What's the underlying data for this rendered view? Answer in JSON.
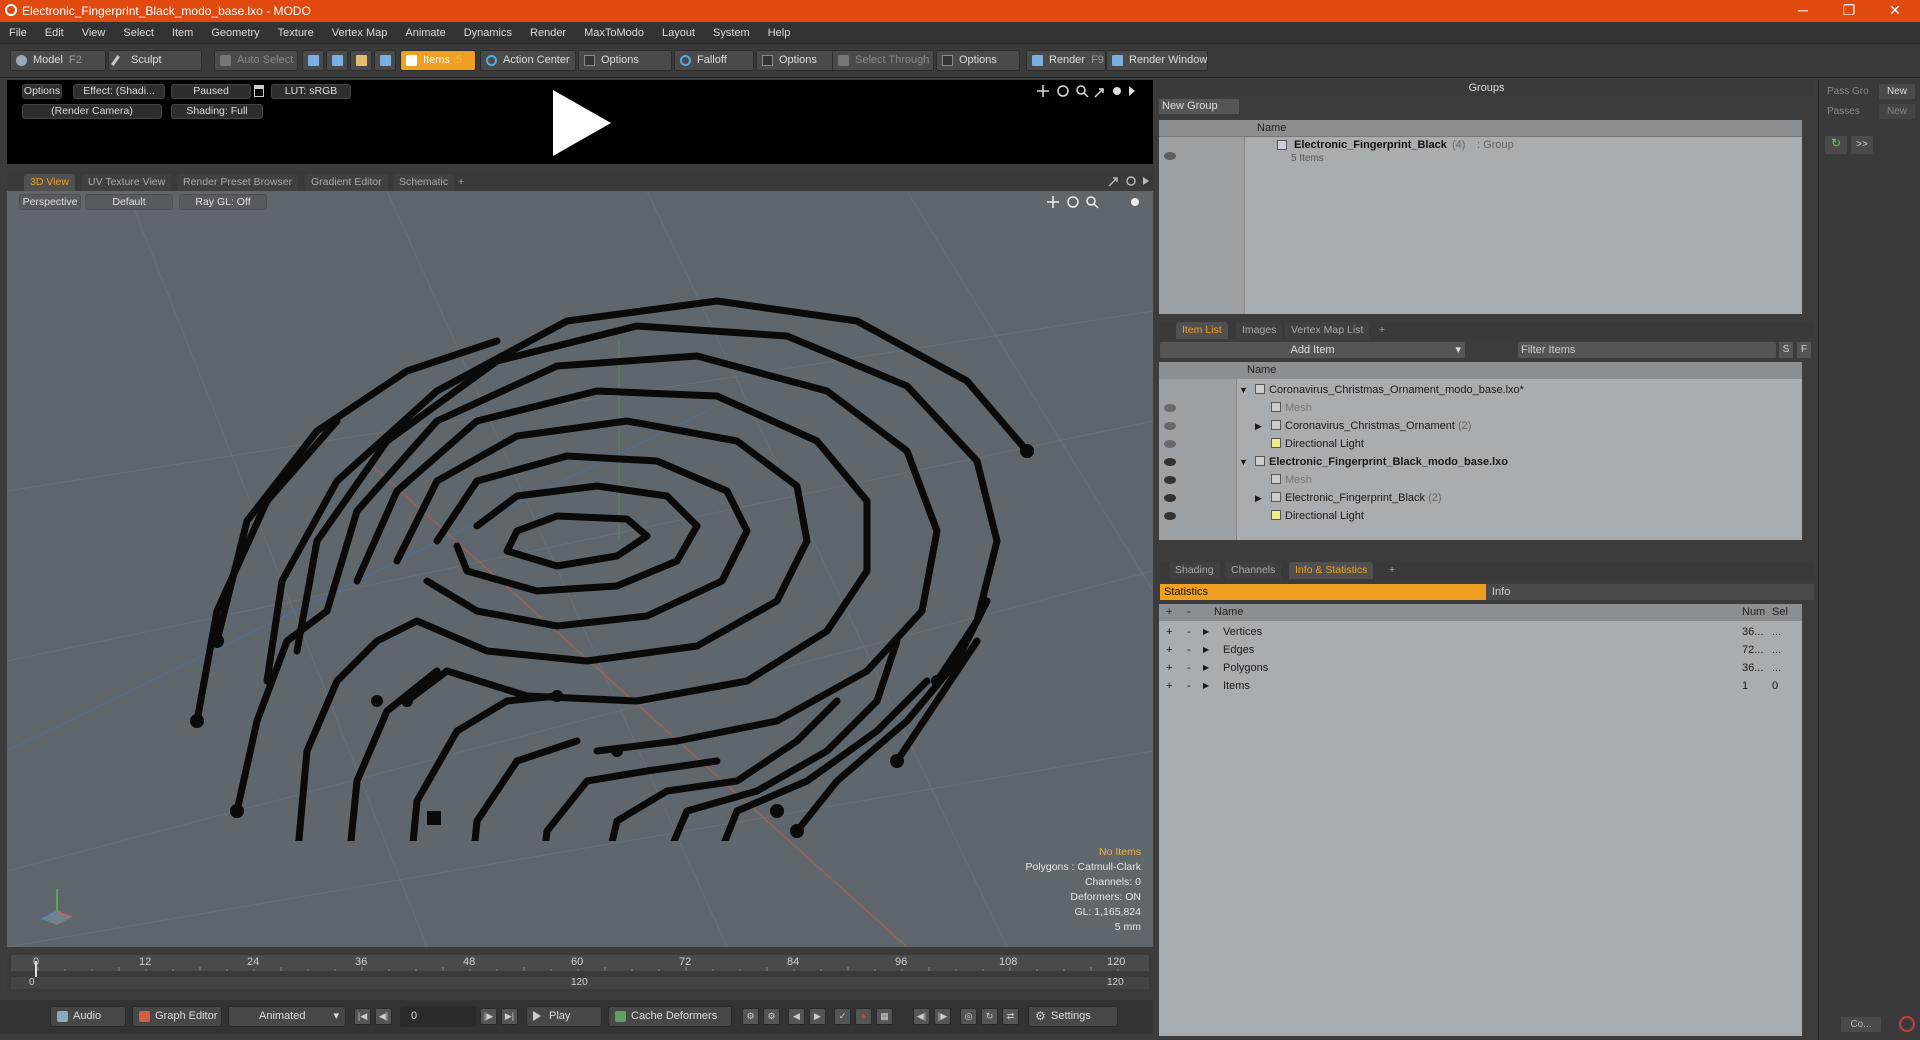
{
  "window": {
    "title": "Electronic_Fingerprint_Black_modo_base.lxo - MODO",
    "minimize": "─",
    "maximize": "❐",
    "close": "✕"
  },
  "menu": [
    "File",
    "Edit",
    "View",
    "Select",
    "Item",
    "Geometry",
    "Texture",
    "Vertex Map",
    "Animate",
    "Dynamics",
    "Render",
    "MaxToModo",
    "Layout",
    "System",
    "Help"
  ],
  "toolbar": {
    "model": "Model",
    "model_key": "F2",
    "sculpt": "Sculpt",
    "auto_select": "Auto Select",
    "items": "Items",
    "items_key": "5",
    "action_center": "Action Center",
    "options1": "Options",
    "falloff": "Falloff",
    "options2": "Options",
    "select_through": "Select Through",
    "options3": "Options",
    "render": "Render",
    "render_key": "F9",
    "render_window": "Render Window"
  },
  "preview": {
    "options": "Options",
    "effect": "Effect: (Shadi...",
    "paused": "Paused",
    "lut": "LUT: sRGB",
    "camera": "(Render Camera)",
    "shading": "Shading: Full"
  },
  "view_tabs": [
    "3D View",
    "UV Texture View",
    "Render Preset Browser",
    "Gradient Editor",
    "Schematic",
    "+"
  ],
  "viewport": {
    "perspective": "Perspective",
    "default": "Default",
    "raygl": "Ray GL: Off",
    "info": {
      "no_items": "No Items",
      "polygons": "Polygons : Catmull-Clark",
      "channels": "Channels: 0",
      "deformers": "Deformers: ON",
      "gl": "GL: 1,165,824",
      "scale": "5 mm"
    }
  },
  "timeline": {
    "ticks": [
      "0",
      "12",
      "24",
      "36",
      "48",
      "60",
      "72",
      "84",
      "96",
      "108",
      "120"
    ],
    "lower_start": "0",
    "lower_mid": "120",
    "lower_end": "120"
  },
  "bottom": {
    "audio": "Audio",
    "graph_editor": "Graph Editor",
    "animated": "Animated",
    "frame": "0",
    "play": "Play",
    "cache": "Cache Deformers",
    "settings": "Settings"
  },
  "groups": {
    "title": "Groups",
    "new_group": "New Group",
    "col_name": "Name",
    "row_name": "Electronic_Fingerprint_Black",
    "row_count": "(4)",
    "row_type": ": Group",
    "row_sub": "5 Items"
  },
  "side": {
    "pass_group": "Pass Gro",
    "new1": "New",
    "passes": "Passes",
    "new2": "New",
    "more": ">>",
    "co": "Co..."
  },
  "item_tabs": [
    "Item List",
    "Images",
    "Vertex Map List",
    "+"
  ],
  "item_list": {
    "add_item": "Add Item",
    "filter": "Filter Items",
    "s": "S",
    "f": "F",
    "col_name": "Name",
    "rows": [
      {
        "name": "Coronavirus_Christmas_Ornament_modo_base.lxo*",
        "indent": 0,
        "bold": false
      },
      {
        "name": "Mesh",
        "indent": 1,
        "bold": false
      },
      {
        "name": "Coronavirus_Christmas_Ornament",
        "suffix": "(2)",
        "indent": 1,
        "bold": false
      },
      {
        "name": "Directional Light",
        "indent": 1,
        "bold": false
      },
      {
        "name": "Electronic_Fingerprint_Black_modo_base.lxo",
        "indent": 0,
        "bold": true
      },
      {
        "name": "Mesh",
        "indent": 1,
        "bold": false
      },
      {
        "name": "Electronic_Fingerprint_Black",
        "suffix": "(2)",
        "indent": 1,
        "bold": false
      },
      {
        "name": "Directional Light",
        "indent": 1,
        "bold": false
      }
    ]
  },
  "stat_tabs": [
    "Shading",
    "Channels",
    "Info & Statistics",
    "+"
  ],
  "stats": {
    "statistics": "Statistics",
    "info": "Info",
    "col_name": "Name",
    "col_num": "Num",
    "col_sel": "Sel",
    "rows": [
      {
        "name": "Vertices",
        "num": "36...",
        "sel": "..."
      },
      {
        "name": "Edges",
        "num": "72...",
        "sel": "..."
      },
      {
        "name": "Polygons",
        "num": "36...",
        "sel": "..."
      },
      {
        "name": "Items",
        "num": "1",
        "sel": "0"
      }
    ]
  },
  "colors": {
    "accent": "#f0a020",
    "titlebar": "#e04a10",
    "viewport": "#5f666c",
    "panel": "#a8adb2"
  }
}
